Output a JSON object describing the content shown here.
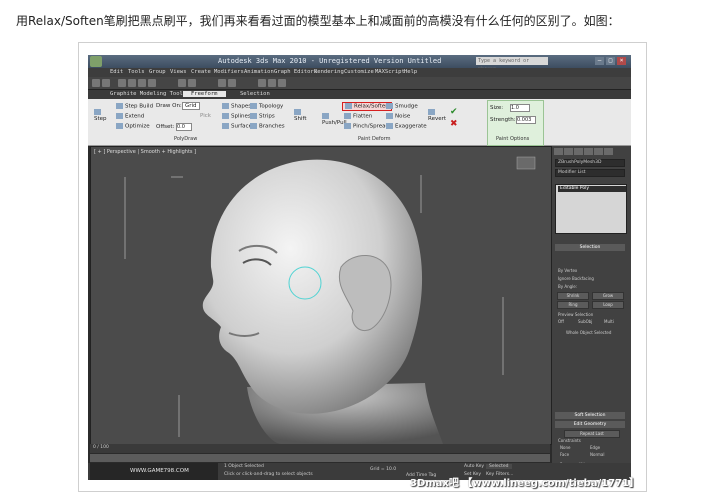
{
  "caption": "用Relax/Soften笔刷把黑点刷平，我们再来看看过面的模型基本上和减面前的高模没有什么任何的区别了。如图：",
  "app": {
    "title": "Autodesk 3ds Max  2010  - Unregistered Version  Untitled",
    "search_placeholder": "Type a keyword or phrase",
    "menu": [
      "Edit",
      "Tools",
      "Group",
      "Views",
      "Create",
      "Modifiers",
      "Animation",
      "Graph Editors",
      "Rendering",
      "Customize",
      "MAXScript",
      "Help"
    ],
    "ribbon_tabs": [
      "Graphite Modeling Tools",
      "Freeform",
      "Selection"
    ],
    "active_tab": "Freeform",
    "ribbon": {
      "step": "Step",
      "step_build": "Step Build",
      "extend": "Extend",
      "optimize": "Optimize",
      "draw_on": "Draw On:",
      "draw_on_value": "Grid",
      "pick": "Pick",
      "offset": "Offset:",
      "offset_value": "0.0",
      "shapes": "Shapes",
      "topology": "Topology",
      "splines": "Splines",
      "strips": "Strips",
      "surface": "Surface",
      "branches": "Branches",
      "shift": "Shift",
      "push_pull": "Push/Pull",
      "relax_soften": "Relax/Soften",
      "flatten": "Flatten",
      "pinch_spread": "Pinch/Spread",
      "smudge": "Smudge",
      "noise": "Noise",
      "exaggerate": "Exaggerate",
      "revert": "Revert",
      "size": "Size:",
      "size_value": "1.0",
      "strength": "Strength:",
      "strength_value": "0.003",
      "group_polydraw": "PolyDraw",
      "group_paint_deform": "Paint Deform",
      "group_paint_options": "Paint Options"
    },
    "viewport_label": "[ + ] Perspective | Smooth + Highlights ]",
    "command_panel": {
      "object_name": "ZBrushPolyMesh3D",
      "modifier_list": "Modifier List",
      "stack_item": "Editable Poly",
      "selection": "Selection",
      "by_vertex": "By Vertex",
      "ignore_backfacing": "Ignore Backfacing",
      "by_angle": "By Angle:",
      "shrink": "Shrink",
      "grow": "Grow",
      "ring": "Ring",
      "loop": "Loop",
      "preview_selection": "Preview Selection",
      "off": "Off",
      "subobj": "SubObj",
      "multi": "Multi",
      "whole_object": "Whole Object Selected",
      "soft_selection": "Soft Selection",
      "edit_geometry": "Edit Geometry",
      "repeat_last": "Repeat Last",
      "constraints": "Constraints",
      "none": "None",
      "edge": "Edge",
      "face": "Face",
      "normal": "Normal",
      "preserve_uvs": "Preserve UVs",
      "create": "Create",
      "collapse": "Collapse",
      "attach": "Attach",
      "detach": "Detach",
      "slice_plane": "Slice Plane",
      "split": "Split"
    },
    "timeline": "0 / 100",
    "status": {
      "selected": "1 Object Selected",
      "hint": "Click or click-and-drag to select objects",
      "grid": "Grid = 10.0",
      "auto_key": "Auto Key",
      "selected_dd": "Selected",
      "set_key": "Set Key",
      "key_filters": "Key Filters...",
      "add_time_tag": "Add Time Tag"
    },
    "watermark": "WWW.GAME798.COM"
  },
  "footer": "3Dmax吧 【www.lineeg.com/tieba/1771】",
  "colors": {
    "highlight_red": "#d61f1f",
    "paint_options_bg": "#dff0dc"
  }
}
